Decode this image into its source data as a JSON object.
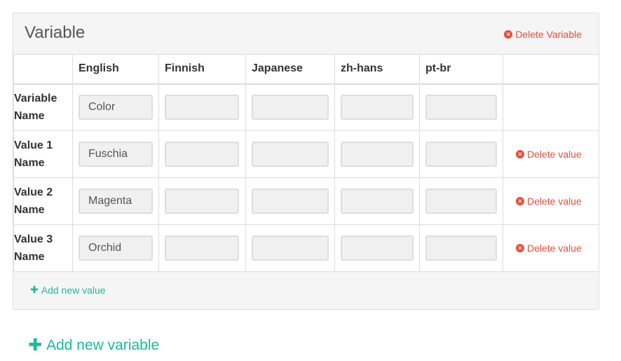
{
  "panel": {
    "title": "Variable",
    "delete_variable_label": "Delete Variable"
  },
  "table": {
    "headers": [
      "",
      "English",
      "Finnish",
      "Japanese",
      "zh-hans",
      "pt-br",
      ""
    ],
    "rows": [
      {
        "label": "Variable Name",
        "values": [
          "Color",
          "",
          "",
          "",
          ""
        ],
        "delete_label": ""
      },
      {
        "label": "Value 1 Name",
        "values": [
          "Fuschia",
          "",
          "",
          "",
          ""
        ],
        "delete_label": "Delete value"
      },
      {
        "label": "Value 2 Name",
        "values": [
          "Magenta",
          "",
          "",
          "",
          ""
        ],
        "delete_label": "Delete value"
      },
      {
        "label": "Value 3 Name",
        "values": [
          "Orchid",
          "",
          "",
          "",
          ""
        ],
        "delete_label": "Delete value"
      }
    ]
  },
  "footer": {
    "add_value_label": "Add new value"
  },
  "add_variable_label": "Add new variable",
  "colors": {
    "danger": "#e74c3c",
    "success": "#18bc9c"
  },
  "icons": {
    "delete": "times-circle-icon",
    "add": "plus-icon"
  }
}
